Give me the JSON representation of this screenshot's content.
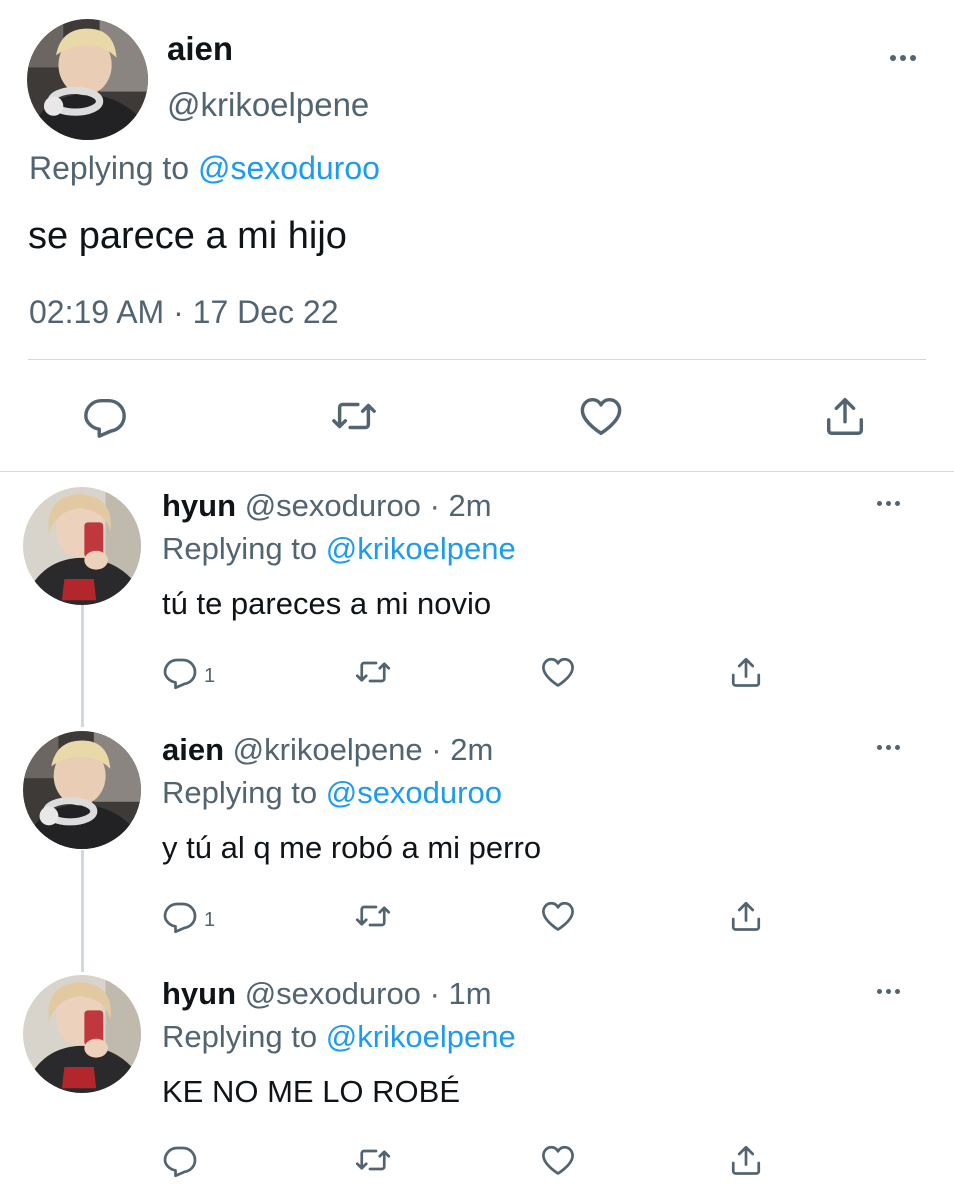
{
  "main_tweet": {
    "name": "aien",
    "handle": "@krikoelpene",
    "replying_label": "Replying to",
    "replying_to": "@sexoduroo",
    "text": "se parece a mi hijo",
    "timestamp": "02:19 AM · 17 Dec 22",
    "actions": [
      "reply-icon",
      "retweet-icon",
      "like-icon",
      "share-icon"
    ]
  },
  "replies": [
    {
      "name": "hyun",
      "handle": "@sexoduroo",
      "separator": "·",
      "time": "2m",
      "replying_label": "Replying to",
      "replying_to": "@krikoelpene",
      "text": "tú te pareces a mi novio",
      "reply_count": "1"
    },
    {
      "name": "aien",
      "handle": "@krikoelpene",
      "separator": "·",
      "time": "2m",
      "replying_label": "Replying to",
      "replying_to": "@sexoduroo",
      "text": "y tú al q me robó a mi perro",
      "reply_count": "1"
    },
    {
      "name": "hyun",
      "handle": "@sexoduroo",
      "separator": "·",
      "time": "1m",
      "replying_label": "Replying to",
      "replying_to": "@krikoelpene",
      "text": "KE NO ME LO ROBÉ",
      "reply_count": ""
    }
  ],
  "colors": {
    "text_primary": "#0f1419",
    "text_secondary": "#536471",
    "link": "#1d9bf0",
    "divider": "#cfd9de"
  }
}
